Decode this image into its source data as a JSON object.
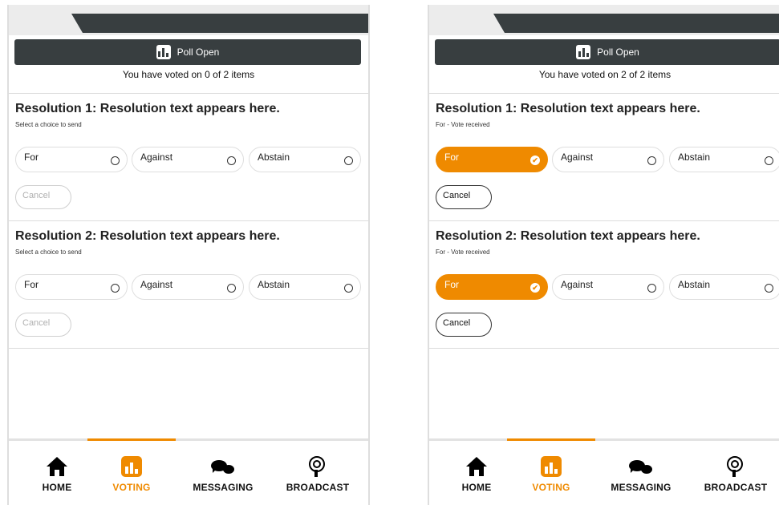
{
  "accent_color": "#ef8a00",
  "dark_color": "#383e40",
  "screens": [
    {
      "poll_status": "Poll Open",
      "votes_summary": "You have voted on 0 of 2 items",
      "resolutions": [
        {
          "title": "Resolution 1: Resolution text appears here.",
          "status": "Select a choice to send",
          "choices": [
            "For",
            "Against",
            "Abstain"
          ],
          "selected": null,
          "cancel_label": "Cancel",
          "cancel_enabled": false
        },
        {
          "title": "Resolution 2: Resolution text appears here.",
          "status": "Select a choice to send",
          "choices": [
            "For",
            "Against",
            "Abstain"
          ],
          "selected": null,
          "cancel_label": "Cancel",
          "cancel_enabled": false
        }
      ],
      "nav": {
        "active": "VOTING",
        "items": [
          {
            "label": "HOME",
            "icon": "home-icon"
          },
          {
            "label": "VOTING",
            "icon": "voting-icon"
          },
          {
            "label": "MESSAGING",
            "icon": "chat-icon"
          },
          {
            "label": "BROADCAST",
            "icon": "broadcast-icon"
          }
        ]
      }
    },
    {
      "poll_status": "Poll Open",
      "votes_summary": "You have voted on 2 of 2 items",
      "resolutions": [
        {
          "title": "Resolution 1: Resolution text appears here.",
          "status": "For - Vote received",
          "choices": [
            "For",
            "Against",
            "Abstain"
          ],
          "selected": "For",
          "cancel_label": "Cancel",
          "cancel_enabled": true
        },
        {
          "title": "Resolution 2: Resolution text appears here.",
          "status": "For - Vote received",
          "choices": [
            "For",
            "Against",
            "Abstain"
          ],
          "selected": "For",
          "cancel_label": "Cancel",
          "cancel_enabled": true
        }
      ],
      "nav": {
        "active": "VOTING",
        "items": [
          {
            "label": "HOME",
            "icon": "home-icon"
          },
          {
            "label": "VOTING",
            "icon": "voting-icon"
          },
          {
            "label": "MESSAGING",
            "icon": "chat-icon"
          },
          {
            "label": "BROADCAST",
            "icon": "broadcast-icon"
          }
        ]
      }
    }
  ]
}
